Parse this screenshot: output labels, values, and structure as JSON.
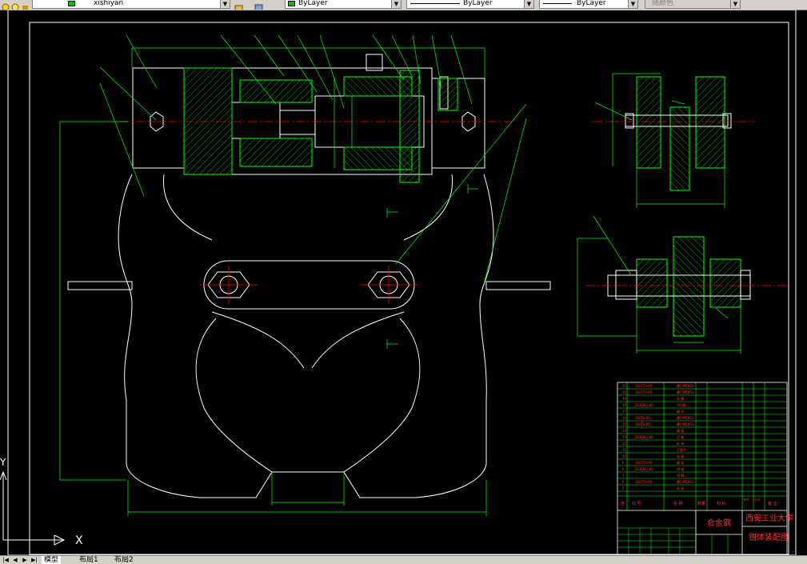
{
  "toolbar": {
    "layer_name": "xishiyan",
    "color_value": "ByLayer",
    "linetype_value": "ByLayer",
    "lineweight_value": "ByLayer",
    "plotstyle_value": "随颜色"
  },
  "title_block": {
    "material_text": "合金钢",
    "school_name": "西安工业大学",
    "drawing_title": "钳体装配图",
    "header": [
      "序",
      "代 号",
      "名 称",
      "数量",
      "材 料",
      "单件",
      "总计",
      "备 注"
    ]
  },
  "ucs": {
    "x_label": "X",
    "y_label": "Y"
  },
  "statusbar": {
    "tabs": [
      "模型",
      "布局1",
      "布局2"
    ]
  },
  "colors": {
    "background": "#000000",
    "geometry": "#ffffff",
    "dimension": "#00ff00",
    "centerline": "#ff0000",
    "border": "#ffffff"
  }
}
